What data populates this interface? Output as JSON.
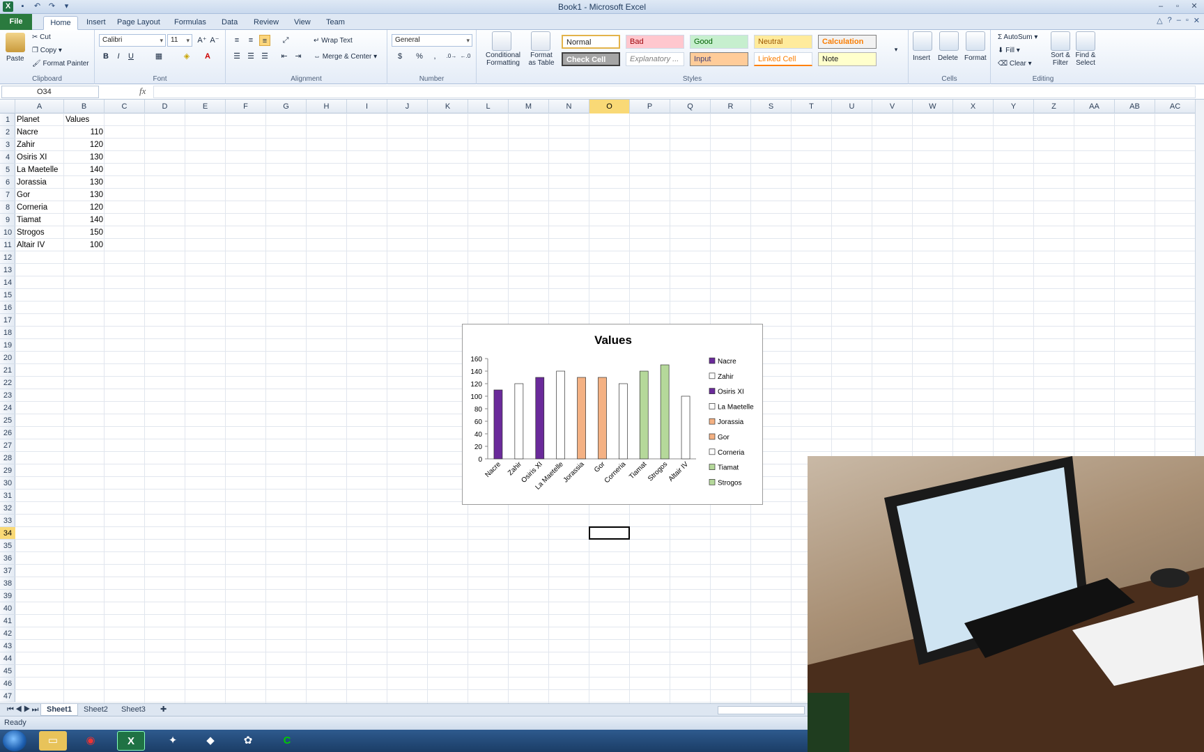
{
  "window": {
    "title": "Book1 - Microsoft Excel"
  },
  "tabs": [
    "File",
    "Home",
    "Insert",
    "Page Layout",
    "Formulas",
    "Data",
    "Review",
    "View",
    "Team"
  ],
  "ribbon": {
    "clipboard": {
      "paste": "Paste",
      "cut": "Cut",
      "copy": "Copy",
      "format_painter": "Format Painter",
      "label": "Clipboard"
    },
    "font": {
      "name": "Calibri",
      "size": "11",
      "bold": "B",
      "italic": "I",
      "underline": "U",
      "label": "Font"
    },
    "alignment": {
      "wrap_text": "Wrap Text",
      "merge_center": "Merge & Center",
      "label": "Alignment"
    },
    "number": {
      "format": "General",
      "currency": "$",
      "percent": "%",
      "comma": ",",
      "label": "Number"
    },
    "styles": {
      "conditional_1": "Conditional",
      "conditional_2": "Formatting",
      "format_table_1": "Format",
      "format_table_2": "as Table",
      "cells": [
        "Normal",
        "Bad",
        "Good",
        "Neutral",
        "Calculation",
        "Check Cell",
        "Explanatory ...",
        "Input",
        "Linked Cell",
        "Note"
      ],
      "label": "Styles"
    },
    "cells": {
      "insert": "Insert",
      "delete": "Delete",
      "format": "Format",
      "label": "Cells"
    },
    "editing": {
      "autosum": "AutoSum",
      "fill": "Fill",
      "clear": "Clear",
      "sort_1": "Sort &",
      "sort_2": "Filter",
      "find_1": "Find &",
      "find_2": "Select",
      "label": "Editing"
    }
  },
  "formula_bar": {
    "name_box": "O34",
    "fx": "fx",
    "formula": ""
  },
  "columns": [
    "A",
    "B",
    "C",
    "D",
    "E",
    "F",
    "G",
    "H",
    "I",
    "J",
    "K",
    "L",
    "M",
    "N",
    "O",
    "P",
    "Q",
    "R",
    "S",
    "T",
    "U",
    "V",
    "W",
    "X",
    "Y",
    "Z",
    "AA",
    "AB",
    "AC"
  ],
  "selected_column": "O",
  "selected_row": 34,
  "rows_visible": 47,
  "sheet": {
    "headers": [
      "Planet",
      "Values"
    ],
    "rows": [
      [
        "Nacre",
        "110"
      ],
      [
        "Zahir",
        "120"
      ],
      [
        "Osiris XI",
        "130"
      ],
      [
        "La Maetelle",
        "140"
      ],
      [
        "Jorassia",
        "130"
      ],
      [
        "Gor",
        "130"
      ],
      [
        "Corneria",
        "120"
      ],
      [
        "Tiamat",
        "140"
      ],
      [
        "Strogos",
        "150"
      ],
      [
        "Altair IV",
        "100"
      ]
    ]
  },
  "chart_data": {
    "type": "bar",
    "title": "Values",
    "categories": [
      "Nacre",
      "Zahir",
      "Osiris XI",
      "La Maetelle",
      "Jorassia",
      "Gor",
      "Corneria",
      "Tiamat",
      "Strogos",
      "Altair IV"
    ],
    "values": [
      110,
      120,
      130,
      140,
      130,
      130,
      120,
      140,
      150,
      100
    ],
    "colors": [
      "#6a2a9a",
      "#ffffff",
      "#6a2a9a",
      "#ffffff",
      "#f4b183",
      "#f4b183",
      "#ffffff",
      "#b5d89a",
      "#b5d89a",
      "#ffffff"
    ],
    "ylim": [
      0,
      160
    ],
    "yticks": [
      "0",
      "20",
      "40",
      "60",
      "80",
      "100",
      "120",
      "140",
      "160"
    ],
    "legend": [
      "Nacre",
      "Zahir",
      "Osiris XI",
      "La Maetelle",
      "Jorassia",
      "Gor",
      "Corneria",
      "Tiamat",
      "Strogos"
    ],
    "legend_position": "right",
    "grid": false
  },
  "sheet_tabs": [
    "Sheet1",
    "Sheet2",
    "Sheet3"
  ],
  "status": {
    "text": "Ready"
  },
  "taskbar": [
    "chrome-icon",
    "excel-icon",
    "folder-icon",
    "app-icon-1",
    "app-icon-2",
    "app-icon-3",
    "camtasia-icon"
  ]
}
